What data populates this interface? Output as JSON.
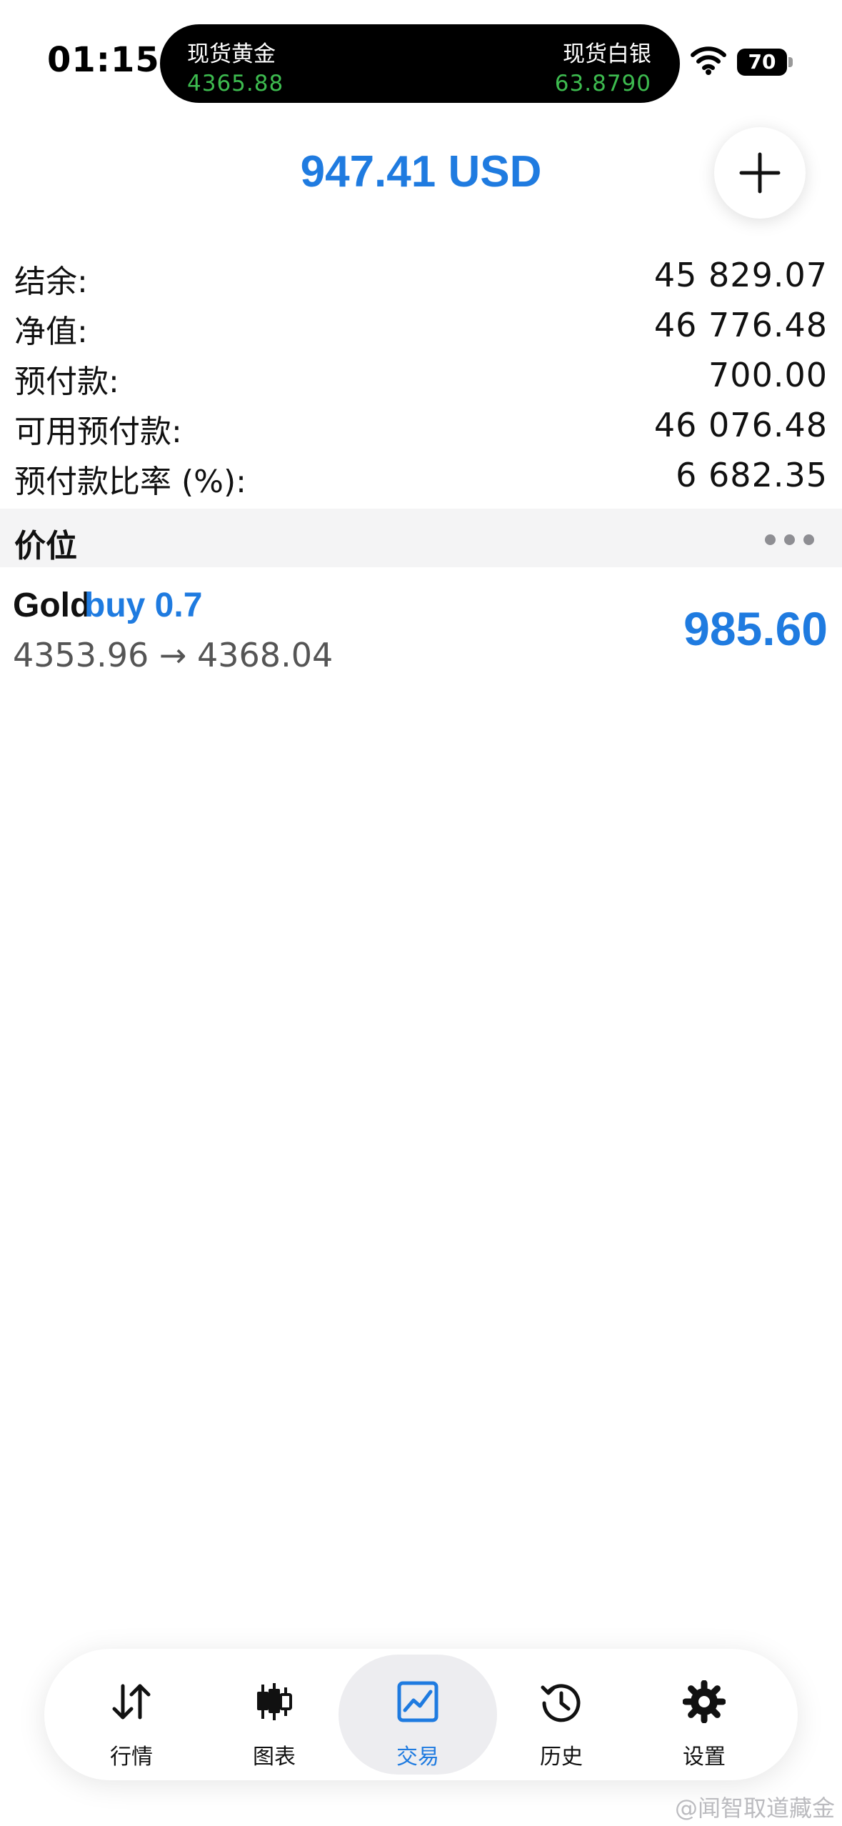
{
  "status_bar": {
    "time": "01:15",
    "battery": "70",
    "ticker": [
      {
        "name": "现货黄金",
        "price": "4365.88"
      },
      {
        "name": "现货白银",
        "price": "63.8790"
      }
    ]
  },
  "header": {
    "profit_total": "947.41 USD",
    "add_icon": "plus-icon"
  },
  "account": {
    "rows": [
      {
        "label": "结余:",
        "value": "45 829.07"
      },
      {
        "label": "净值:",
        "value": "46 776.48"
      },
      {
        "label": "预付款:",
        "value": "700.00"
      },
      {
        "label": "可用预付款:",
        "value": "46 076.48"
      },
      {
        "label": "预付款比率 (%):",
        "value": "6 682.35"
      }
    ]
  },
  "positions": {
    "section_title": "价位",
    "more_icon": "more-dots-icon",
    "items": [
      {
        "symbol": "Gold",
        "side": "buy 0.7",
        "prices": "4353.96 → 4368.04",
        "profit": "985.60"
      }
    ]
  },
  "tabbar": {
    "tabs": [
      {
        "label": "行情",
        "icon": "quotes-arrows-icon",
        "active": false
      },
      {
        "label": "图表",
        "icon": "candlestick-chart-icon",
        "active": false
      },
      {
        "label": "交易",
        "icon": "trade-chart-icon",
        "active": true
      },
      {
        "label": "历史",
        "icon": "history-clock-icon",
        "active": false
      },
      {
        "label": "设置",
        "icon": "settings-gear-icon",
        "active": false
      }
    ]
  },
  "watermark": "@闻智取道藏金",
  "colors": {
    "accent": "#1f7be0",
    "ticker_green": "#3dbb4f",
    "section_bg": "#f4f4f5"
  }
}
